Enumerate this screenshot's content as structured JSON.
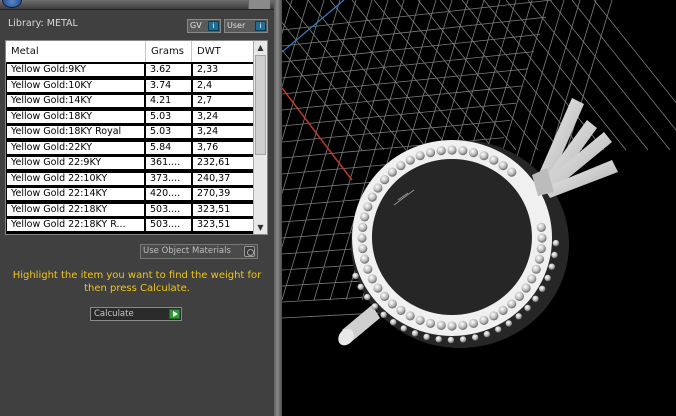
{
  "library": {
    "label": "Library: METAL"
  },
  "toolbar": {
    "gv_label": "GV",
    "user_label": "User",
    "chip": "i"
  },
  "table": {
    "headers": [
      "Metal",
      "Grams",
      "DWT"
    ],
    "rows": [
      [
        "Yellow Gold:9KY",
        "3.62",
        "2,33"
      ],
      [
        "Yellow Gold:10KY",
        "3.74",
        "2,4"
      ],
      [
        "Yellow Gold:14KY",
        "4.21",
        "2,7"
      ],
      [
        "Yellow Gold:18KY",
        "5.03",
        "3,24"
      ],
      [
        "Yellow Gold:18KY Royal",
        "5.03",
        "3,24"
      ],
      [
        "Yellow Gold:22KY",
        "5.84",
        "3,76"
      ],
      [
        "Yellow Gold 22:9KY",
        "361....",
        "232,61"
      ],
      [
        "Yellow Gold 22:10KY",
        "373....",
        "240,37"
      ],
      [
        "Yellow Gold 22:14KY",
        "420....",
        "270,39"
      ],
      [
        "Yellow Gold 22:18KY",
        "503....",
        "323,51"
      ],
      [
        "Yellow Gold 22:18KY R...",
        "503....",
        "323,51"
      ]
    ],
    "scroll_up": "▲",
    "scroll_down": "▼"
  },
  "options": {
    "use_object_materials": "Use Object Materials"
  },
  "instructions": "Highlight the item you want to find the weight for then press Calculate.",
  "calculate": {
    "label": "Calculate"
  },
  "colors": {
    "panel_bg": "#404040",
    "instruction_text": "#f0c419",
    "accent_chip": "#1f6f94",
    "go_green": "#2f9a33",
    "viewport_bg": "#000000",
    "grid": "#8a8a8a"
  },
  "icons": [
    "app-icon",
    "info-icon",
    "chevron-up-icon",
    "chevron-down-icon",
    "radio-icon",
    "play-arrow-icon"
  ]
}
